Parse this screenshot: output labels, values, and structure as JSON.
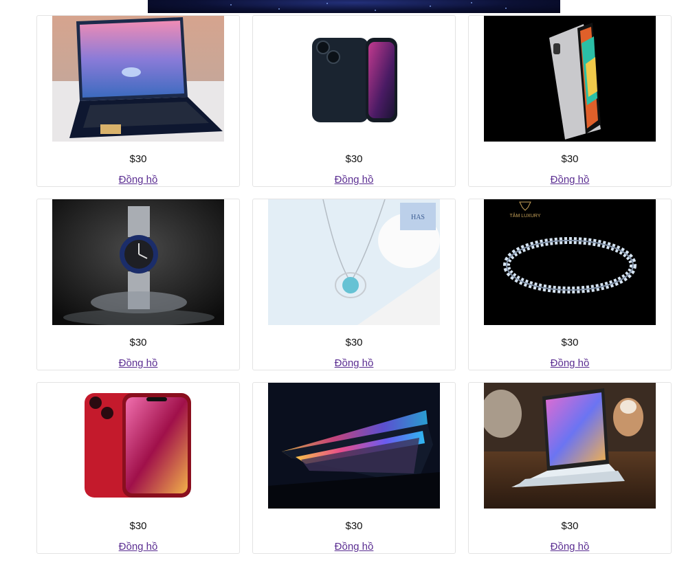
{
  "products": [
    {
      "image": "laptop-water-splash-photo",
      "price": "$30",
      "name": "Đồng hồ"
    },
    {
      "image": "midnight-iphone-photo",
      "price": "$30",
      "name": "Đồng hồ"
    },
    {
      "image": "ipad-pro-photo",
      "price": "$30",
      "name": "Đồng hồ"
    },
    {
      "image": "luxury-watch-photo",
      "price": "$30",
      "name": "Đồng hồ"
    },
    {
      "image": "blue-pendant-necklace-photo",
      "price": "$30",
      "name": "Đồng hồ"
    },
    {
      "image": "diamond-bracelet-photo",
      "price": "$30",
      "name": "Đồng hồ"
    },
    {
      "image": "red-iphone-photo",
      "price": "$30",
      "name": "Đồng hồ"
    },
    {
      "image": "colorful-macbook-photo",
      "price": "$30",
      "name": "Đồng hồ"
    },
    {
      "image": "ipad-magic-keyboard-photo",
      "price": "$30",
      "name": "Đồng hồ"
    }
  ],
  "brand_text": {
    "necklace_logo": "HAS",
    "bracelet_logo": "TÂM LUXURY"
  }
}
